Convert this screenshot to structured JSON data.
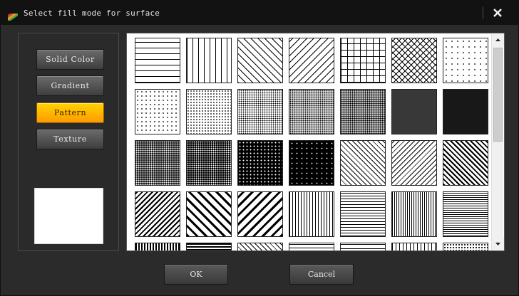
{
  "window": {
    "title": "Select fill mode for surface",
    "icons": {
      "app": "palette-icon",
      "close": "close-icon"
    }
  },
  "modes": [
    {
      "label": "Solid Color",
      "active": false
    },
    {
      "label": "Gradient",
      "active": false
    },
    {
      "label": "Pattern",
      "active": true
    },
    {
      "label": "Texture",
      "active": false
    }
  ],
  "colors": {
    "active_mode": "#ffb800",
    "preview_fill": "#ffffff",
    "titlebar": "#121212",
    "panel": "#2b2b2b"
  },
  "patterns": [
    "horizontal-lines",
    "vertical-lines",
    "wide-downward-diagonal",
    "wide-upward-diagonal",
    "large-grid",
    "diagonal-cross",
    "percent-5",
    "percent-10",
    "percent-20",
    "percent-25",
    "percent-30",
    "percent-40",
    "percent-50",
    "percent-60",
    "percent-70",
    "percent-75",
    "percent-80",
    "percent-90",
    "light-downward-diagonal",
    "light-upward-diagonal",
    "dark-downward-diagonal",
    "dark-upward-diagonal",
    "wide-downward-diagonal-bold",
    "wide-upward-diagonal-bold",
    "light-vertical",
    "light-horizontal",
    "narrow-vertical",
    "narrow-horizontal",
    "dark-vertical",
    "dark-horizontal",
    "dashed-downward-diagonal",
    "dashed-upward-diagonal",
    "dashed-horizontal",
    "dashed-vertical",
    "small-confetti"
  ],
  "buttons": {
    "ok": "OK",
    "cancel": "Cancel"
  }
}
